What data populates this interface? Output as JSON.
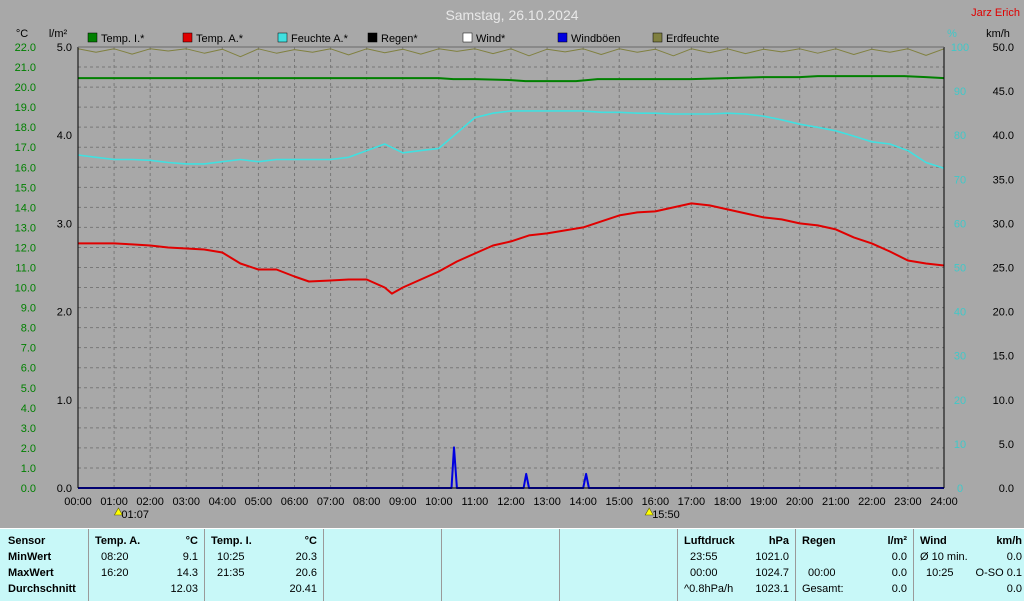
{
  "chart_data": {
    "type": "line",
    "title": "Samstag, 26.10.2024",
    "author": "Jarz Erich",
    "left_axis_unit": "°C",
    "left_axis2_unit": "l/m²",
    "right_axis_unit": "%",
    "right_axis2_unit": "km/h",
    "x_ticks": [
      "00:00",
      "01:00",
      "02:00",
      "03:00",
      "04:00",
      "05:00",
      "06:00",
      "07:00",
      "08:00",
      "09:00",
      "10:00",
      "11:00",
      "12:00",
      "13:00",
      "14:00",
      "15:00",
      "16:00",
      "17:00",
      "18:00",
      "19:00",
      "20:00",
      "21:00",
      "22:00",
      "23:00",
      "24:00"
    ],
    "temp_ticks": [
      "0.0",
      "1.0",
      "2.0",
      "3.0",
      "4.0",
      "5.0",
      "6.0",
      "7.0",
      "8.0",
      "9.0",
      "10.0",
      "11.0",
      "12.0",
      "13.0",
      "14.0",
      "15.0",
      "16.0",
      "17.0",
      "18.0",
      "19.0",
      "20.0",
      "21.0",
      "22.0"
    ],
    "rain_ticks": [
      "0.0",
      "1.0",
      "2.0",
      "3.0",
      "4.0",
      "5.0"
    ],
    "hum_ticks": [
      "0",
      "10",
      "20",
      "30",
      "40",
      "50",
      "60",
      "70",
      "80",
      "90",
      "100"
    ],
    "wind_ticks": [
      "0.0",
      "5.0",
      "10.0",
      "15.0",
      "20.0",
      "25.0",
      "30.0",
      "35.0",
      "40.0",
      "45.0",
      "50.0"
    ],
    "temp_range": [
      0,
      22
    ],
    "hum_range": [
      0,
      100
    ],
    "wind_range": [
      0,
      50
    ],
    "x_range_hours": [
      0,
      24
    ],
    "grid": true,
    "legend_position": "top",
    "sun_markers": [
      {
        "label": "01:07",
        "hour": 1.12
      },
      {
        "label": "15:50",
        "hour": 15.83
      }
    ],
    "colors": {
      "temp_inside": "#008000",
      "temp_outside": "#e00000",
      "humidity": "#40e0e0",
      "rain": "#000000",
      "wind": "#ffffff",
      "gusts": "#0000e0",
      "radiation": "#808040",
      "left_axis_text": "#008000",
      "right_axis_text": "#40c8c8"
    },
    "series": [
      {
        "name": "Temp. I.*",
        "key": "temp_inside",
        "axis": "temp",
        "points": [
          [
            0,
            20.45
          ],
          [
            1,
            20.45
          ],
          [
            2,
            20.45
          ],
          [
            3,
            20.45
          ],
          [
            4,
            20.45
          ],
          [
            5,
            20.45
          ],
          [
            6,
            20.45
          ],
          [
            7,
            20.45
          ],
          [
            8,
            20.45
          ],
          [
            9,
            20.45
          ],
          [
            10,
            20.45
          ],
          [
            10.4,
            20.4
          ],
          [
            11,
            20.4
          ],
          [
            12,
            20.35
          ],
          [
            12.4,
            20.3
          ],
          [
            13,
            20.3
          ],
          [
            13.8,
            20.3
          ],
          [
            14.4,
            20.4
          ],
          [
            15,
            20.4
          ],
          [
            16,
            20.4
          ],
          [
            17,
            20.4
          ],
          [
            18,
            20.45
          ],
          [
            19,
            20.5
          ],
          [
            20,
            20.5
          ],
          [
            20.5,
            20.55
          ],
          [
            21,
            20.55
          ],
          [
            22,
            20.55
          ],
          [
            22.9,
            20.55
          ],
          [
            23.5,
            20.5
          ],
          [
            24,
            20.45
          ]
        ]
      },
      {
        "name": "Temp. A.*",
        "key": "temp_outside",
        "axis": "temp",
        "points": [
          [
            0,
            12.2
          ],
          [
            1,
            12.2
          ],
          [
            1.5,
            12.15
          ],
          [
            2,
            12.1
          ],
          [
            2.5,
            12.0
          ],
          [
            3,
            11.95
          ],
          [
            3.5,
            11.9
          ],
          [
            4,
            11.75
          ],
          [
            4.5,
            11.2
          ],
          [
            5,
            10.9
          ],
          [
            5.5,
            10.9
          ],
          [
            6,
            10.55
          ],
          [
            6.4,
            10.3
          ],
          [
            7,
            10.35
          ],
          [
            7.5,
            10.4
          ],
          [
            8,
            10.4
          ],
          [
            8.5,
            10.0
          ],
          [
            8.7,
            9.7
          ],
          [
            9,
            10.0
          ],
          [
            9.5,
            10.4
          ],
          [
            10,
            10.8
          ],
          [
            10.5,
            11.3
          ],
          [
            11,
            11.7
          ],
          [
            11.5,
            12.1
          ],
          [
            12,
            12.3
          ],
          [
            12.5,
            12.6
          ],
          [
            13,
            12.7
          ],
          [
            13.5,
            12.85
          ],
          [
            14,
            13.0
          ],
          [
            14.5,
            13.3
          ],
          [
            15,
            13.6
          ],
          [
            15.5,
            13.75
          ],
          [
            16,
            13.8
          ],
          [
            16.5,
            14.0
          ],
          [
            17,
            14.2
          ],
          [
            17.5,
            14.1
          ],
          [
            18,
            13.9
          ],
          [
            18.5,
            13.7
          ],
          [
            19,
            13.5
          ],
          [
            19.5,
            13.4
          ],
          [
            20,
            13.2
          ],
          [
            20.5,
            13.1
          ],
          [
            21,
            12.9
          ],
          [
            21.5,
            12.5
          ],
          [
            22,
            12.2
          ],
          [
            22.5,
            11.8
          ],
          [
            23,
            11.35
          ],
          [
            23.5,
            11.2
          ],
          [
            24,
            11.1
          ]
        ]
      },
      {
        "name": "Feuchte A.*",
        "key": "humidity",
        "axis": "hum",
        "points": [
          [
            0,
            75.5
          ],
          [
            0.5,
            75.0
          ],
          [
            1,
            74.5
          ],
          [
            1.5,
            74.5
          ],
          [
            2,
            74.3
          ],
          [
            2.5,
            73.8
          ],
          [
            3,
            73.5
          ],
          [
            3.5,
            73.5
          ],
          [
            4,
            74.0
          ],
          [
            4.5,
            74.5
          ],
          [
            5,
            74.0
          ],
          [
            5.5,
            74.5
          ],
          [
            6,
            74.5
          ],
          [
            6.5,
            74.5
          ],
          [
            7,
            74.5
          ],
          [
            7.5,
            75.0
          ],
          [
            8,
            76.5
          ],
          [
            8.5,
            78.0
          ],
          [
            9,
            76.0
          ],
          [
            9.5,
            76.5
          ],
          [
            10,
            77.0
          ],
          [
            10.5,
            80.5
          ],
          [
            11,
            84.0
          ],
          [
            11.5,
            85.0
          ],
          [
            12,
            85.5
          ],
          [
            12.5,
            85.5
          ],
          [
            13,
            85.5
          ],
          [
            13.5,
            85.5
          ],
          [
            14,
            85.5
          ],
          [
            14.5,
            85.2
          ],
          [
            15,
            85.2
          ],
          [
            15.5,
            85.0
          ],
          [
            16,
            85.0
          ],
          [
            16.5,
            84.8
          ],
          [
            17,
            84.8
          ],
          [
            17.5,
            84.8
          ],
          [
            18,
            85.0
          ],
          [
            18.5,
            84.8
          ],
          [
            19,
            84.3
          ],
          [
            19.5,
            83.5
          ],
          [
            20,
            82.5
          ],
          [
            20.5,
            81.8
          ],
          [
            21,
            81.0
          ],
          [
            21.5,
            79.8
          ],
          [
            22,
            78.5
          ],
          [
            22.5,
            78.0
          ],
          [
            23,
            76.5
          ],
          [
            23.5,
            73.8
          ],
          [
            24,
            72.5
          ]
        ]
      },
      {
        "name": "Regen*",
        "key": "rain",
        "axis": "rain",
        "points": [
          [
            0,
            0
          ],
          [
            24,
            0
          ]
        ]
      },
      {
        "name": "Wind*",
        "key": "wind",
        "axis": "wind",
        "points": [
          [
            0,
            0
          ],
          [
            24,
            0
          ]
        ]
      },
      {
        "name": "Windböen",
        "key": "gusts",
        "axis": "wind",
        "points": [
          [
            0,
            0
          ],
          [
            10.35,
            0
          ],
          [
            10.42,
            4.6
          ],
          [
            10.5,
            0
          ],
          [
            12.35,
            0
          ],
          [
            12.42,
            1.6
          ],
          [
            12.5,
            0
          ],
          [
            14.0,
            0
          ],
          [
            14.08,
            1.6
          ],
          [
            14.16,
            0
          ],
          [
            24,
            0
          ]
        ]
      },
      {
        "name": "Erdfeuchte",
        "key": "radiation",
        "axis": "hum",
        "points": [
          [
            0,
            99.6
          ],
          [
            0.5,
            98.8
          ],
          [
            1,
            99.6
          ],
          [
            1.5,
            98.4
          ],
          [
            2,
            99.6
          ],
          [
            2.5,
            99.1
          ],
          [
            3,
            99.6
          ],
          [
            3.5,
            98.6
          ],
          [
            4,
            99.5
          ],
          [
            4.5,
            97.8
          ],
          [
            5,
            99.6
          ],
          [
            5.5,
            98.6
          ],
          [
            6,
            99.4
          ],
          [
            6.5,
            98.8
          ],
          [
            7,
            99.6
          ],
          [
            7.5,
            98.2
          ],
          [
            8,
            99.6
          ],
          [
            8.5,
            98.7
          ],
          [
            9,
            99.5
          ],
          [
            9.5,
            98.4
          ],
          [
            10,
            99.6
          ],
          [
            10.5,
            99.0
          ],
          [
            11,
            99.6
          ],
          [
            11.5,
            98.5
          ],
          [
            12,
            99.6
          ],
          [
            12.5,
            98.0
          ],
          [
            13,
            99.5
          ],
          [
            13.5,
            98.9
          ],
          [
            14,
            99.6
          ],
          [
            14.5,
            98.3
          ],
          [
            15,
            99.6
          ],
          [
            15.5,
            98.8
          ],
          [
            16,
            99.5
          ],
          [
            16.5,
            98.0
          ],
          [
            17,
            99.6
          ],
          [
            17.5,
            98.7
          ],
          [
            18,
            99.6
          ],
          [
            18.5,
            98.5
          ],
          [
            19,
            99.5
          ],
          [
            19.5,
            98.9
          ],
          [
            20,
            99.6
          ],
          [
            20.5,
            98.6
          ],
          [
            21,
            99.6
          ],
          [
            21.5,
            98.3
          ],
          [
            22,
            99.5
          ],
          [
            22.5,
            98.8
          ],
          [
            23,
            99.6
          ],
          [
            23.5,
            98.1
          ],
          [
            24,
            99.6
          ]
        ]
      }
    ]
  },
  "table": {
    "sensor": {
      "header": "Sensor",
      "rows": [
        "MinWert",
        "MaxWert",
        "Durchschnitt"
      ]
    },
    "temp_a": {
      "header": "Temp. A.",
      "unit": "°C",
      "min_time": "08:20",
      "min_val": "9.1",
      "max_time": "16:20",
      "max_val": "14.3",
      "avg_val": "12.03"
    },
    "temp_i": {
      "header": "Temp. I.",
      "unit": "°C",
      "min_time": "10:25",
      "min_val": "20.3",
      "max_time": "21:35",
      "max_val": "20.6",
      "avg_val": "20.41"
    },
    "pressure": {
      "header": "Luftdruck",
      "unit": "hPa",
      "min_time": "23:55",
      "min_val": "1021.0",
      "max_time": "00:00",
      "max_val": "1024.7",
      "avg_time": "^0.8hPa/h",
      "avg_val": "1023.1"
    },
    "rain": {
      "header": "Regen",
      "unit": "l/m²",
      "min_val": "0.0",
      "max_time": "00:00",
      "max_val": "0.0",
      "avg_time": "Gesamt:",
      "avg_val": "0.0"
    },
    "wind": {
      "header": "Wind",
      "unit": "km/h",
      "min_time": "Ø 10 min.",
      "min_val": "0.0",
      "max_time": "10:25",
      "max_val": "O-SO 0.1",
      "avg_val": "0.0"
    }
  }
}
